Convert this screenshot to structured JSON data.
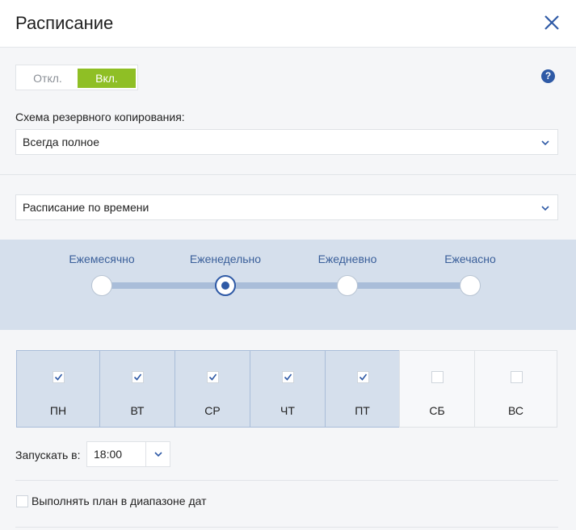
{
  "dialog": {
    "title": "Расписание",
    "close_icon": "close-icon",
    "help_icon": "help-icon",
    "help_glyph": "?"
  },
  "toggle": {
    "off_label": "Откл.",
    "on_label": "Вкл.",
    "selected": "on",
    "accent_color": "#8fbf25"
  },
  "backup_scheme": {
    "label": "Схема резервного копирования:",
    "value": "Всегда полное"
  },
  "schedule_type": {
    "value": "Расписание по времени"
  },
  "frequency": {
    "options": [
      "Ежемесячно",
      "Еженедельно",
      "Ежедневно",
      "Ежечасно"
    ],
    "selected": "Еженедельно",
    "accent_color": "#2f5aa6"
  },
  "days": [
    {
      "label": "ПН",
      "checked": true
    },
    {
      "label": "ВТ",
      "checked": true
    },
    {
      "label": "СР",
      "checked": true
    },
    {
      "label": "ЧТ",
      "checked": true
    },
    {
      "label": "ПТ",
      "checked": true
    },
    {
      "label": "СБ",
      "checked": false
    },
    {
      "label": "ВС",
      "checked": false
    }
  ],
  "run_at": {
    "label": "Запускать в:",
    "value": "18:00"
  },
  "date_range": {
    "label": "Выполнять план в диапазоне дат",
    "checked": false
  }
}
